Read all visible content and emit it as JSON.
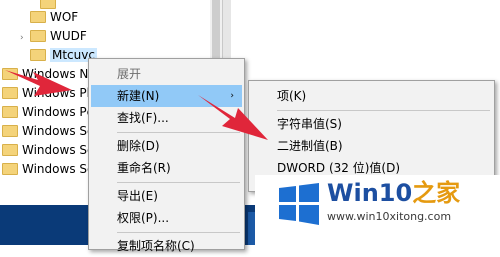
{
  "tree": {
    "top_cut_label": "",
    "items": [
      {
        "label": "WOF",
        "expander": ""
      },
      {
        "label": "WUDF",
        "expander": "›"
      },
      {
        "label": "Mtcuvc",
        "expander": ""
      },
      {
        "label": "Windows N"
      },
      {
        "label": "Windows Ph"
      },
      {
        "label": "Windows Pc"
      },
      {
        "label": "Windows Sc"
      },
      {
        "label": "Windows Se"
      },
      {
        "label": "Windows Se"
      }
    ]
  },
  "context_menu": {
    "items": [
      {
        "label": "展开"
      },
      {
        "label": "新建(N)",
        "submenu_arrow": "›"
      },
      {
        "label": "查找(F)..."
      },
      {
        "label": "删除(D)"
      },
      {
        "label": "重命名(R)"
      },
      {
        "label": "导出(E)"
      },
      {
        "label": "权限(P)..."
      },
      {
        "label": "复制项名称(C)"
      }
    ]
  },
  "submenu": {
    "items": [
      {
        "label": "项(K)"
      },
      {
        "label": "字符串值(S)"
      },
      {
        "label": "二进制值(B)"
      },
      {
        "label": "DWORD (32 位)值(D)"
      }
    ]
  },
  "watermark": {
    "title_win": "Win10",
    "title_zh": "之家",
    "url": "www.win10xitong.com",
    "logo_colors": [
      "#1d6fd1",
      "#1d6fd1",
      "#1d6fd1",
      "#1d6fd1"
    ]
  },
  "colors": {
    "highlight": "#91c9f7",
    "arrow_red": "#e0263a",
    "taskbar": "#0a3a78"
  }
}
